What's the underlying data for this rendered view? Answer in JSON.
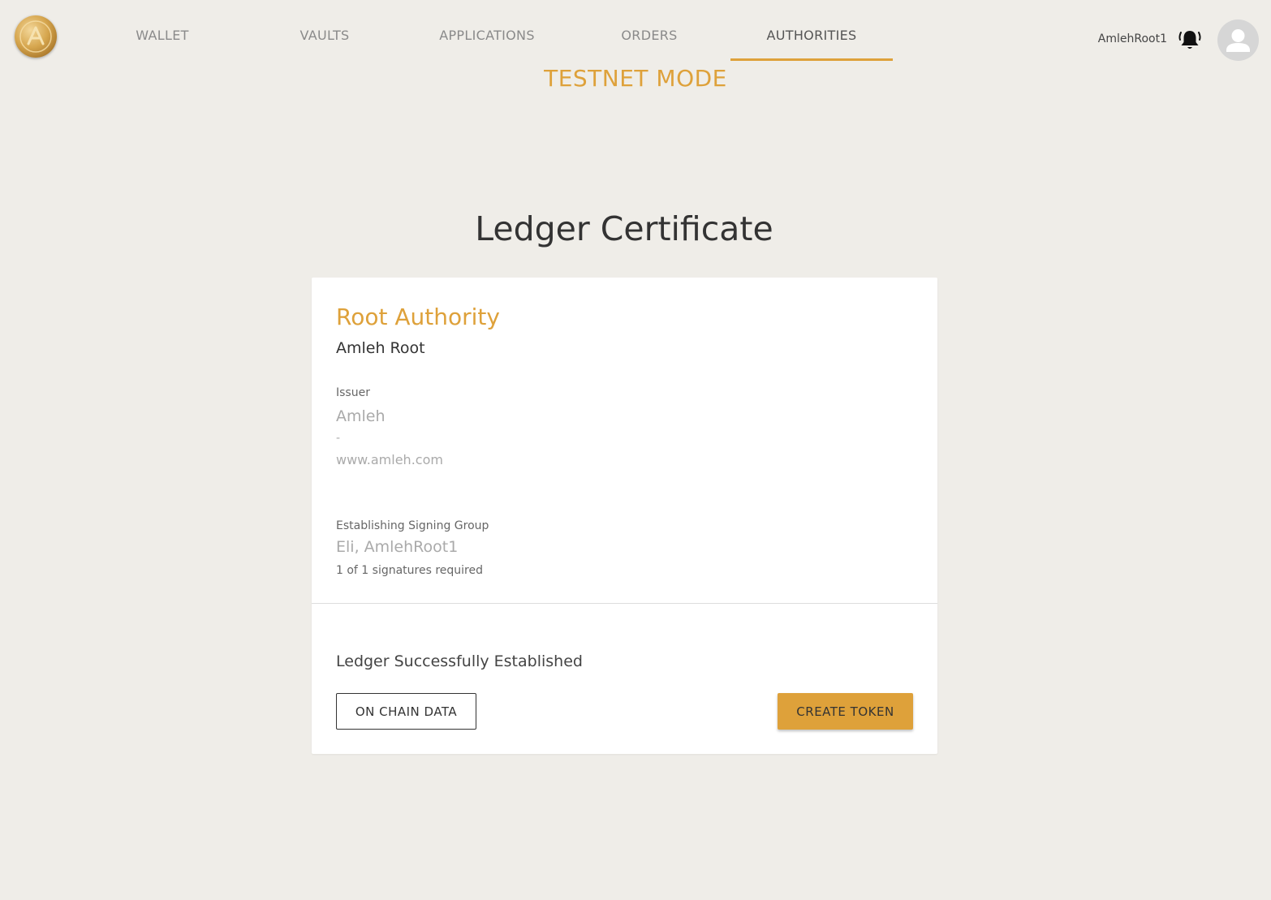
{
  "colors": {
    "accent": "#dea13a",
    "background": "#efede8",
    "card": "#ffffff"
  },
  "logo": {
    "icon": "amleh-coin-logo"
  },
  "nav": {
    "items": [
      {
        "label": "WALLET",
        "active": false
      },
      {
        "label": "VAULTS",
        "active": false
      },
      {
        "label": "APPLICATIONS",
        "active": false
      },
      {
        "label": "ORDERS",
        "active": false
      },
      {
        "label": "AUTHORITIES",
        "active": true
      }
    ]
  },
  "user": {
    "username": "AmlehRoot1",
    "notification_icon": "bell-icon",
    "avatar_icon": "user-avatar-icon"
  },
  "mode_banner": "TESTNET MODE",
  "page_title": "Ledger Certificate",
  "certificate": {
    "authority_type": "Root Authority",
    "authority_name": "Amleh Root",
    "issuer_label": "Issuer",
    "issuer_name": "Amleh",
    "issuer_separator": "-",
    "issuer_url": "www.amleh.com",
    "signing_group_label": "Establishing Signing Group",
    "signing_group_members": "Eli, AmlehRoot1",
    "signatures_required": "1 of 1 signatures required",
    "status": "Ledger Successfully Established",
    "on_chain_button": "ON CHAIN DATA",
    "create_token_button": "CREATE TOKEN"
  }
}
